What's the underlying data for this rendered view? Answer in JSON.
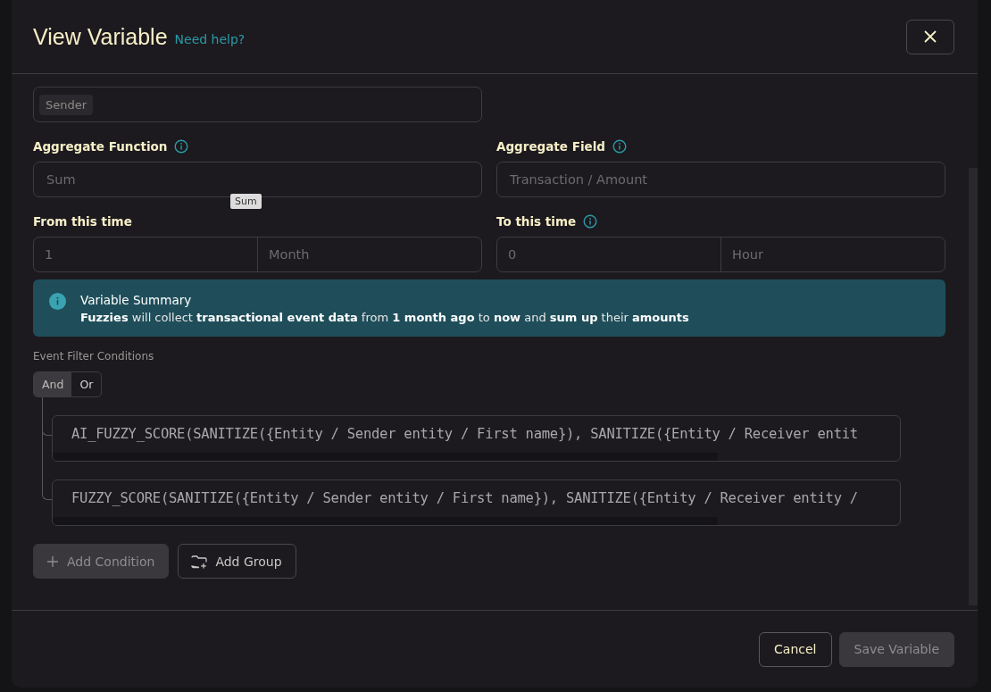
{
  "dialog": {
    "title": "View Variable",
    "help_link": "Need help?"
  },
  "group_by": {
    "tags": [
      "Sender"
    ]
  },
  "fields": [
    {
      "label": "Aggregate Function",
      "has_info": true,
      "value": "Sum",
      "tooltip": "Sum"
    },
    {
      "label": "Aggregate Field",
      "has_info": true,
      "value": "Transaction / Amount"
    }
  ],
  "time_ranges": [
    {
      "label": "From this time",
      "has_info": false,
      "amount": "1",
      "unit": "Month"
    },
    {
      "label": "To this time",
      "has_info": true,
      "amount": "0",
      "unit": "Hour"
    }
  ],
  "summary": {
    "title": "Variable Summary",
    "text": "**Fuzzies** will collect **transactional event data** from **1 month ago** to **now** and **sum up** their **amounts**"
  },
  "filters": {
    "label": "Event Filter Conditions",
    "operators": [
      {
        "label": "And",
        "selected": true
      },
      {
        "label": "Or",
        "selected": false
      }
    ],
    "conditions": [
      {
        "expression": "AI_FUZZY_SCORE(SANITIZE({Entity / Sender entity / First name}), SANITIZE({Entity / Receiver entit"
      },
      {
        "expression": "FUZZY_SCORE(SANITIZE({Entity / Sender entity / First name}), SANITIZE({Entity / Receiver entity /"
      }
    ]
  },
  "actions": [
    {
      "label": "Add Condition",
      "kind": "add",
      "disabled": true
    },
    {
      "label": "Add Group",
      "kind": "group",
      "disabled": false
    }
  ],
  "footer": [
    {
      "label": "Cancel",
      "disabled": false
    },
    {
      "label": "Save Variable",
      "disabled": true
    }
  ]
}
